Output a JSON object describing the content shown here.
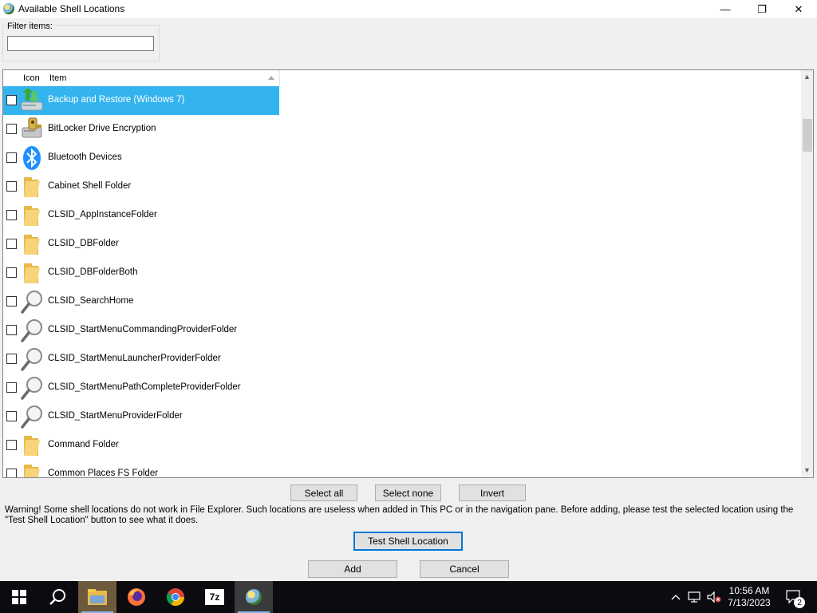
{
  "window": {
    "title": "Available Shell Locations",
    "controls": {
      "minimize": "—",
      "maximize": "❐",
      "close": "✕"
    }
  },
  "filter": {
    "label": "Filter items:",
    "value": "",
    "placeholder": ""
  },
  "list": {
    "columns": {
      "icon": "Icon",
      "item": "Item"
    },
    "sort": "ascending",
    "items": [
      {
        "label": "Backup and Restore (Windows 7)",
        "icon": "backup-restore-icon",
        "checked": false,
        "selected": true
      },
      {
        "label": "BitLocker Drive Encryption",
        "icon": "bitlocker-icon",
        "checked": false,
        "selected": false
      },
      {
        "label": "Bluetooth Devices",
        "icon": "bluetooth-icon",
        "checked": false,
        "selected": false
      },
      {
        "label": "Cabinet Shell Folder",
        "icon": "folder-icon",
        "checked": false,
        "selected": false
      },
      {
        "label": "CLSID_AppInstanceFolder",
        "icon": "folder-icon",
        "checked": false,
        "selected": false
      },
      {
        "label": "CLSID_DBFolder",
        "icon": "folder-icon",
        "checked": false,
        "selected": false
      },
      {
        "label": "CLSID_DBFolderBoth",
        "icon": "folder-icon",
        "checked": false,
        "selected": false
      },
      {
        "label": "CLSID_SearchHome",
        "icon": "search-icon",
        "checked": false,
        "selected": false
      },
      {
        "label": "CLSID_StartMenuCommandingProviderFolder",
        "icon": "search-icon",
        "checked": false,
        "selected": false
      },
      {
        "label": "CLSID_StartMenuLauncherProviderFolder",
        "icon": "search-icon",
        "checked": false,
        "selected": false
      },
      {
        "label": "CLSID_StartMenuPathCompleteProviderFolder",
        "icon": "search-icon",
        "checked": false,
        "selected": false
      },
      {
        "label": "CLSID_StartMenuProviderFolder",
        "icon": "search-icon",
        "checked": false,
        "selected": false
      },
      {
        "label": "Command Folder",
        "icon": "folder-icon",
        "checked": false,
        "selected": false
      },
      {
        "label": "Common Places FS Folder",
        "icon": "folder-icon",
        "checked": false,
        "selected": false
      }
    ],
    "scroll_position": 0.08
  },
  "selection_buttons": {
    "select_all": "Select all",
    "select_none": "Select none",
    "invert": "Invert"
  },
  "warning": "Warning! Some shell locations do not work in File Explorer. Such locations are useless when added in This PC or in the navigation pane. Before adding, please test the selected location using the \"Test Shell Location\" button to see what it does.",
  "actions": {
    "test": "Test Shell Location",
    "add": "Add",
    "cancel": "Cancel"
  },
  "taskbar": {
    "apps": [
      "start-icon",
      "search-icon",
      "file-explorer-icon",
      "firefox-icon",
      "chrome-icon",
      "7zip-icon",
      "winaero-tweaker-icon"
    ],
    "seven_zip_label": "7z",
    "time": "10:56 AM",
    "date": "7/13/2023",
    "notifications_count": "2"
  },
  "colors": {
    "selection": "#33b4ee",
    "folder": "#f3c94c",
    "bluetooth": "#1e90ff",
    "taskbar": "#0c0c10",
    "primary_border": "#0078d7"
  }
}
